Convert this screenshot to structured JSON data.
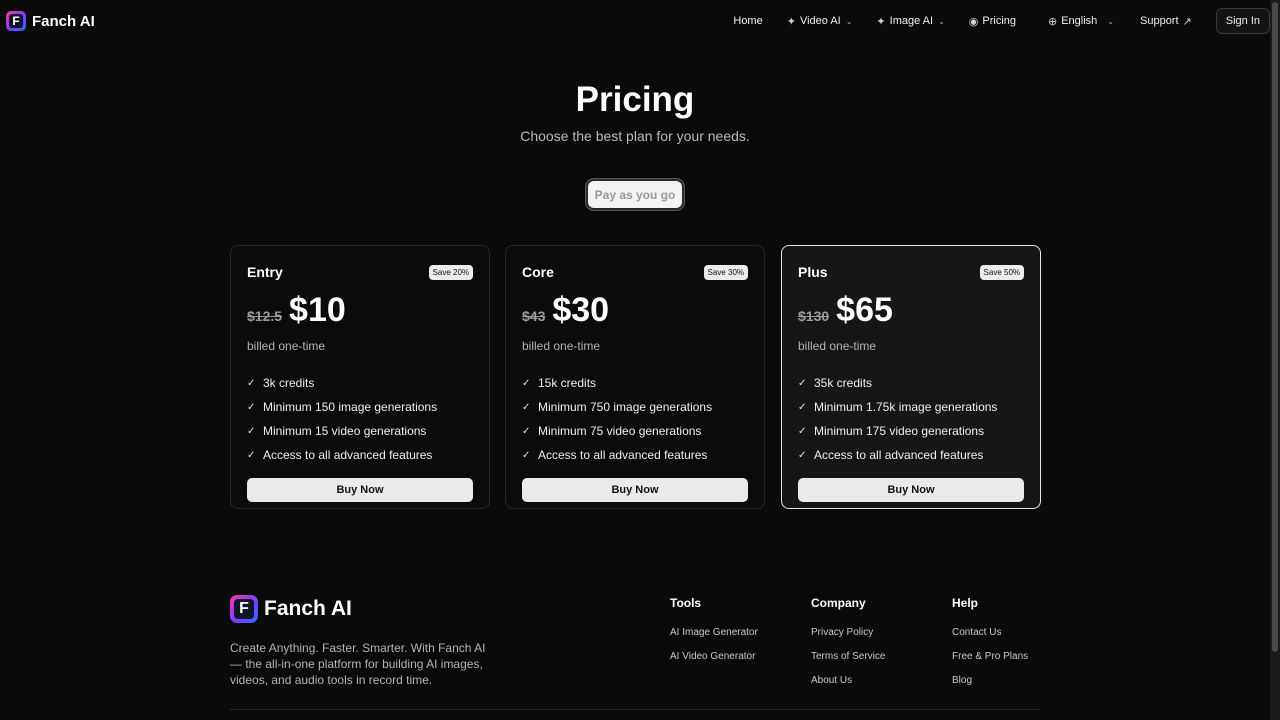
{
  "brand": {
    "name": "Fanch AI",
    "logo_letter": "F"
  },
  "nav": {
    "items": [
      {
        "label": "Home",
        "icon": "",
        "has_dropdown": false
      },
      {
        "label": "Video AI",
        "icon": "sparkle-icon",
        "has_dropdown": true
      },
      {
        "label": "Image AI",
        "icon": "sparkle-icon",
        "has_dropdown": true
      },
      {
        "label": "Pricing",
        "icon": "pricing-circle-icon",
        "has_dropdown": false
      },
      {
        "label": "English",
        "icon": "globe-icon",
        "has_dropdown": true
      },
      {
        "label": "Support",
        "icon": "external-arrow-icon",
        "has_dropdown": false
      }
    ],
    "signin_label": "Sign In"
  },
  "hero": {
    "title": "Pricing",
    "subtitle": "Choose the best plan for your needs.",
    "toggle_label": "Pay as you go"
  },
  "plans": [
    {
      "name": "Entry",
      "badge": "Save 20%",
      "old_price": "$12.5",
      "price": "$10",
      "billing": "billed one-time",
      "features": [
        "3k credits",
        "Minimum 150 image generations",
        "Minimum 15 video generations",
        "Access to all advanced features"
      ],
      "cta": "Buy Now",
      "featured": false
    },
    {
      "name": "Core",
      "badge": "Save 30%",
      "old_price": "$43",
      "price": "$30",
      "billing": "billed one-time",
      "features": [
        "15k credits",
        "Minimum 750 image generations",
        "Minimum 75 video generations",
        "Access to all advanced features"
      ],
      "cta": "Buy Now",
      "featured": false
    },
    {
      "name": "Plus",
      "badge": "Save 50%",
      "old_price": "$130",
      "price": "$65",
      "billing": "billed one-time",
      "features": [
        "35k credits",
        "Minimum 1.75k image generations",
        "Minimum 175 video generations",
        "Access to all advanced features"
      ],
      "cta": "Buy Now",
      "featured": true
    }
  ],
  "footer": {
    "brand_name": "Fanch AI",
    "description": "Create Anything. Faster. Smarter. With Fanch AI — the all-in-one platform for building AI images, videos, and audio tools in record time.",
    "columns": [
      {
        "title": "Tools",
        "links": [
          "AI Image Generator",
          "AI Video Generator"
        ]
      },
      {
        "title": "Company",
        "links": [
          "Privacy Policy",
          "Terms of Service",
          "About Us"
        ]
      },
      {
        "title": "Help",
        "links": [
          "Contact Us",
          "Free & Pro Plans",
          "Blog"
        ]
      }
    ]
  },
  "colors": {
    "background": "#0a0a0a",
    "accent_gradient_start": "#ff3aa7",
    "accent_gradient_end": "#2a6bff"
  }
}
